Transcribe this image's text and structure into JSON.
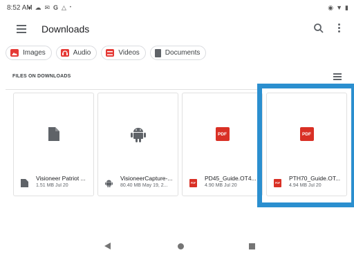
{
  "status_bar": {
    "time": "8:52 AM",
    "left_icons": [
      "notification-dot-icon",
      "cloud-icon",
      "chat-icon",
      "google-icon",
      "drive-icon",
      "more-notifications-dot-icon"
    ],
    "right_icons": [
      "vibrate-icon",
      "wifi-icon",
      "battery-icon"
    ]
  },
  "app_bar": {
    "title": "Downloads"
  },
  "chips": [
    {
      "label": "Images",
      "color": "#e53935"
    },
    {
      "label": "Audio",
      "color": "#e53935"
    },
    {
      "label": "Videos",
      "color": "#e53935"
    },
    {
      "label": "Documents",
      "color": "#5f6368"
    }
  ],
  "section": {
    "label": "FILES ON DOWNLOADS"
  },
  "files": [
    {
      "name": "Visioneer Patriot ...",
      "meta": "1.51 MB Jul 20",
      "type": "file",
      "icon": "document-icon"
    },
    {
      "name": "VisioneerCapture-...",
      "meta": "80.40 MB May 19, 2...",
      "type": "apk",
      "icon": "android-icon"
    },
    {
      "name": "PD45_Guide.OT4...",
      "meta": "4.90 MB Jul 20",
      "type": "pdf",
      "icon": "pdf-icon",
      "badge": "PDF"
    },
    {
      "name": "PTH70_Guide.OT...",
      "meta": "4.94 MB Jul 20",
      "type": "pdf",
      "icon": "pdf-icon",
      "badge": "PDF"
    }
  ],
  "colors": {
    "accent_highlight": "#2b8fcf",
    "pdf_red": "#d93025",
    "icon_gray": "#5f6368"
  }
}
